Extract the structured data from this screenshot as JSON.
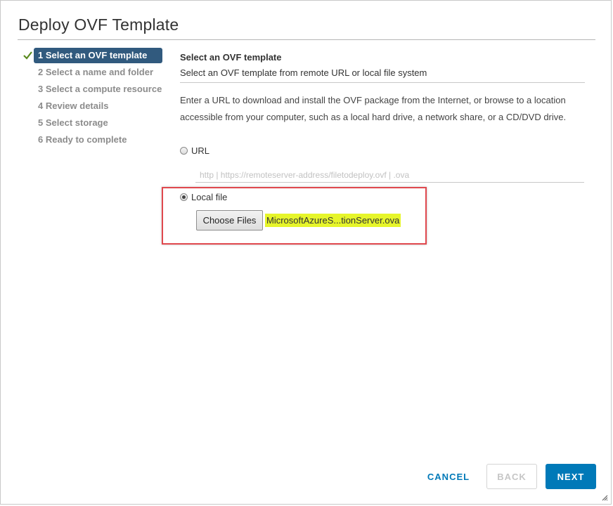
{
  "dialog": {
    "title": "Deploy OVF Template"
  },
  "steps": [
    {
      "label": "1 Select an OVF template",
      "active": true,
      "completed": true
    },
    {
      "label": "2 Select a name and folder",
      "active": false
    },
    {
      "label": "3 Select a compute resource",
      "active": false
    },
    {
      "label": "4 Review details",
      "active": false
    },
    {
      "label": "5 Select storage",
      "active": false
    },
    {
      "label": "6 Ready to complete",
      "active": false
    }
  ],
  "main": {
    "title": "Select an OVF template",
    "subtitle": "Select an OVF template from remote URL or local file system",
    "description": "Enter a URL to download and install the OVF package from the Internet, or browse to a location accessible from your computer, such as a local hard drive, a network share, or a CD/DVD drive.",
    "url_option": {
      "label": "URL",
      "selected": false,
      "placeholder": "http | https://remoteserver-address/filetodeploy.ovf | .ova"
    },
    "local_option": {
      "label": "Local file",
      "selected": true
    },
    "choose_files_label": "Choose Files",
    "selected_file": "MicrosoftAzureS...tionServer.ova"
  },
  "footer": {
    "cancel": "CANCEL",
    "back": "BACK",
    "next": "NEXT"
  },
  "colors": {
    "accent": "#0079b8",
    "active_step_bg": "#315a7e",
    "check": "#5a8a1e",
    "highlight_border": "#e0484e",
    "file_highlight": "#e6f52a"
  }
}
